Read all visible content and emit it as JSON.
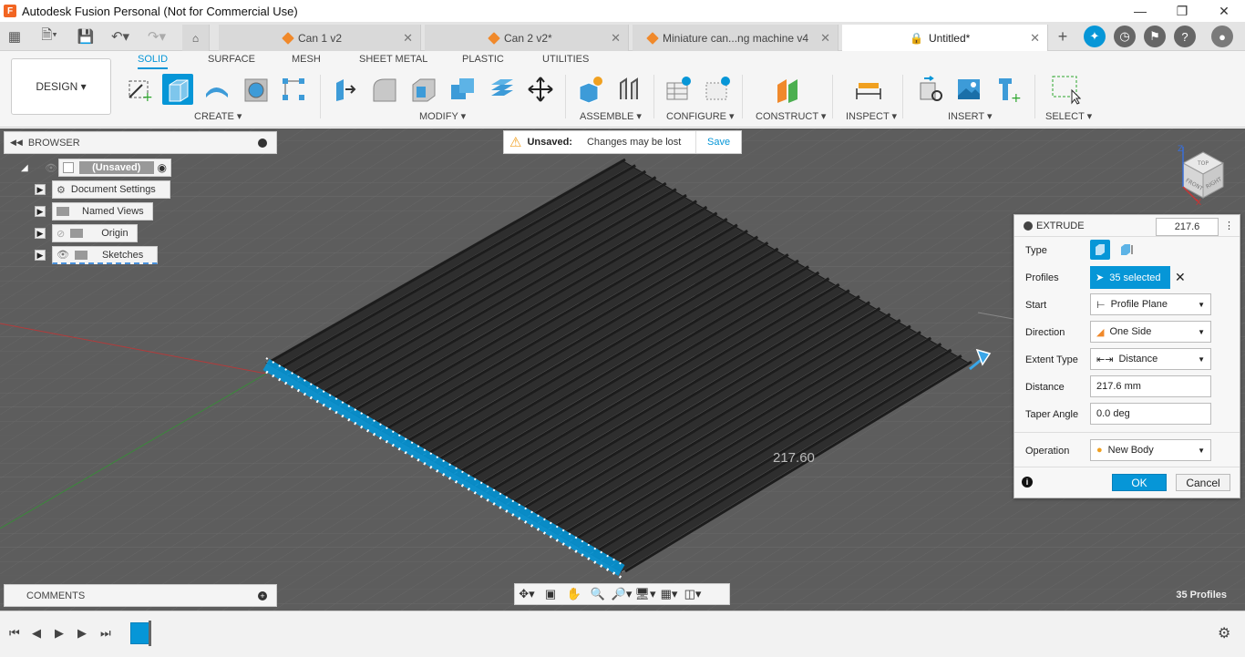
{
  "window": {
    "title": "Autodesk Fusion Personal (Not for Commercial Use)",
    "app_icon": "F"
  },
  "tabs": [
    {
      "label": "Can 1 v2",
      "icon": "cube-icon"
    },
    {
      "label": "Can 2 v2*",
      "icon": "cube-icon"
    },
    {
      "label": "Miniature can...ng machine v4",
      "icon": "cube-icon"
    },
    {
      "label": "Untitled*",
      "icon": "lock-icon",
      "active": true
    }
  ],
  "ribbon": {
    "workspace": "DESIGN",
    "tabs": [
      "SOLID",
      "SURFACE",
      "MESH",
      "SHEET METAL",
      "PLASTIC",
      "UTILITIES"
    ],
    "active_tab": "SOLID",
    "groups": [
      "CREATE",
      "MODIFY",
      "ASSEMBLE",
      "CONFIGURE",
      "CONSTRUCT",
      "INSPECT",
      "INSERT",
      "SELECT"
    ]
  },
  "browser": {
    "title": "BROWSER",
    "root": "(Unsaved)",
    "items": [
      "Document Settings",
      "Named Views",
      "Origin",
      "Sketches"
    ]
  },
  "unsaved_bar": {
    "label": "Unsaved:",
    "message": "Changes may be lost",
    "save": "Save"
  },
  "extrude": {
    "title": "EXTRUDE",
    "header_value": "217.6",
    "type_label": "Type",
    "profiles_label": "Profiles",
    "profiles_value": "35 selected",
    "start_label": "Start",
    "start_value": "Profile Plane",
    "direction_label": "Direction",
    "direction_value": "One Side",
    "extent_label": "Extent Type",
    "extent_value": "Distance",
    "distance_label": "Distance",
    "distance_value": "217.6 mm",
    "taper_label": "Taper Angle",
    "taper_value": "0.0 deg",
    "operation_label": "Operation",
    "operation_value": "New Body",
    "ok": "OK",
    "cancel": "Cancel"
  },
  "viewport": {
    "dimension_label": "217.60",
    "status": "35 Profiles",
    "viewcube_faces": [
      "TOP",
      "FRONT",
      "RIGHT"
    ],
    "accent": "#0696d7"
  },
  "comments": {
    "title": "COMMENTS"
  }
}
